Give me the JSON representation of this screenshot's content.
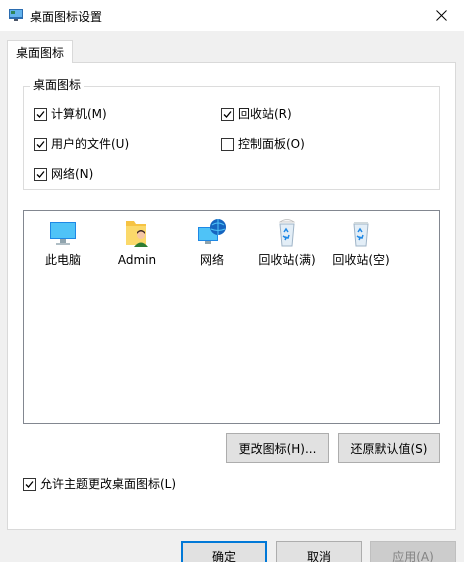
{
  "window": {
    "title": "桌面图标设置",
    "close_icon": "close-icon"
  },
  "tabs": [
    {
      "label": "桌面图标"
    }
  ],
  "desktop_icons_group": {
    "legend": "桌面图标",
    "items": [
      {
        "label": "计算机(M)",
        "checked": true
      },
      {
        "label": "回收站(R)",
        "checked": true
      },
      {
        "label": "用户的文件(U)",
        "checked": true
      },
      {
        "label": "控制面板(O)",
        "checked": false
      },
      {
        "label": "网络(N)",
        "checked": true
      }
    ]
  },
  "icon_list": [
    {
      "label": "此电脑",
      "icon": "computer-icon"
    },
    {
      "label": "Admin",
      "icon": "user-folder-icon"
    },
    {
      "label": "网络",
      "icon": "network-icon"
    },
    {
      "label": "回收站(满)",
      "icon": "recycle-bin-full-icon"
    },
    {
      "label": "回收站(空)",
      "icon": "recycle-bin-empty-icon"
    }
  ],
  "buttons": {
    "change_icon": "更改图标(H)...",
    "restore_default": "还原默认值(S)",
    "ok": "确定",
    "cancel": "取消",
    "apply": "应用(A)"
  },
  "allow_themes": {
    "label": "允许主题更改桌面图标(L)",
    "checked": true
  },
  "colors": {
    "accent": "#0078d7"
  }
}
